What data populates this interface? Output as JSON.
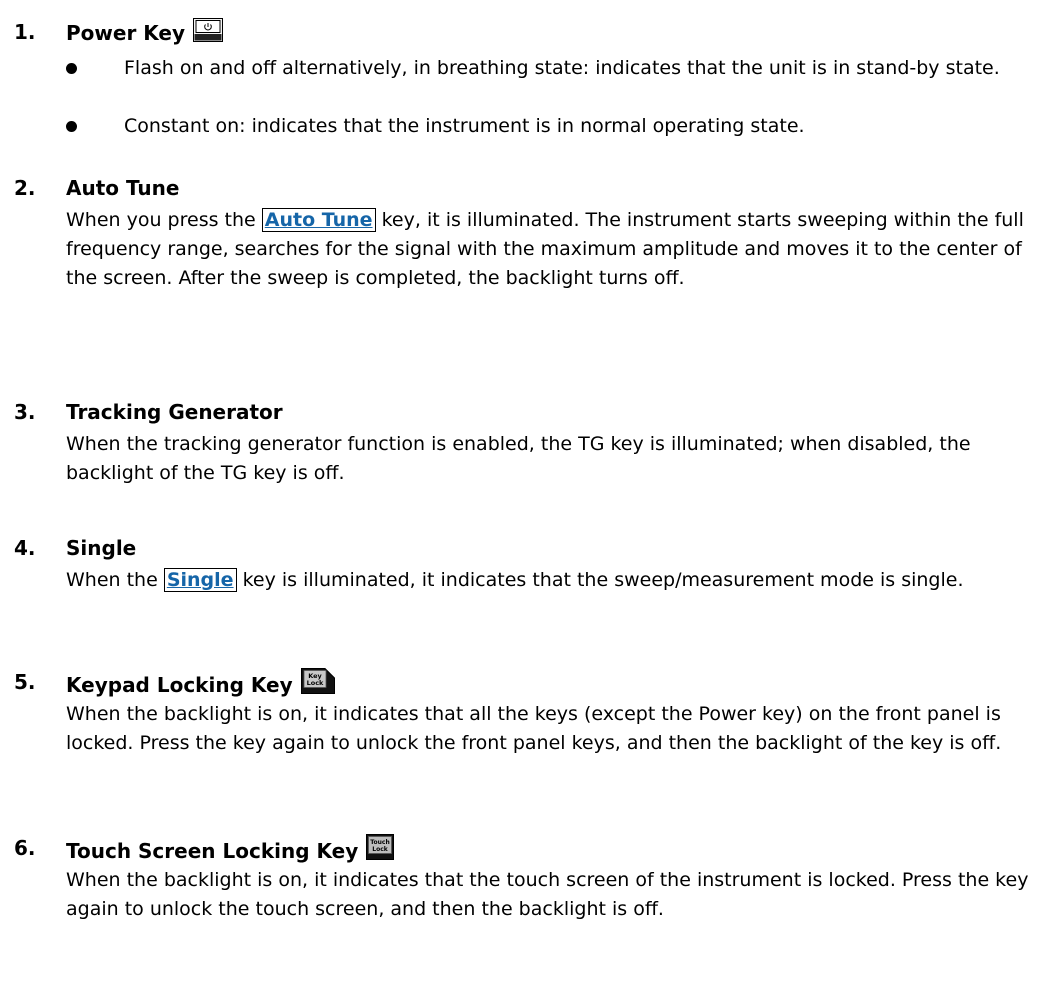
{
  "sections": [
    {
      "num": "1.",
      "title": "Power Key",
      "icon": "power-key-icon",
      "bullets": [
        "Flash on and off alternatively, in breathing state: indicates that the unit is in stand-by state.",
        "Constant on: indicates that the instrument is in normal operating state."
      ]
    },
    {
      "num": "2.",
      "title": "Auto Tune",
      "text_before": "When you press the ",
      "key": "Auto Tune",
      "text_after": " key, it is illuminated. The instrument starts sweeping within the full frequency range, searches for the signal with the maximum amplitude and moves it to the center of the screen. After the sweep is completed, the backlight turns off."
    },
    {
      "num": "3.",
      "title": "Tracking Generator",
      "text": "When the tracking generator function is enabled, the TG key is illuminated; when disabled, the backlight of the TG key is off."
    },
    {
      "num": "4.",
      "title": "Single",
      "text_before": "When the ",
      "key": "Single",
      "text_after": " key is illuminated, it indicates that the sweep/measurement mode is single."
    },
    {
      "num": "5.",
      "title": "Keypad Locking Key",
      "icon": "key-lock-icon",
      "icon_text": [
        "Key",
        "Lock"
      ],
      "text": "When the backlight is on, it indicates that all the keys (except the Power key) on the front panel is locked. Press the key again to unlock the front panel keys, and then the backlight of the key is off."
    },
    {
      "num": "6.",
      "title": "Touch Screen Locking Key",
      "icon": "touch-lock-icon",
      "icon_text": [
        "Touch",
        "Lock"
      ],
      "text": "When the backlight is on, it indicates that the touch screen of the instrument is locked. Press the key again to unlock the touch screen, and then the backlight is off."
    }
  ]
}
